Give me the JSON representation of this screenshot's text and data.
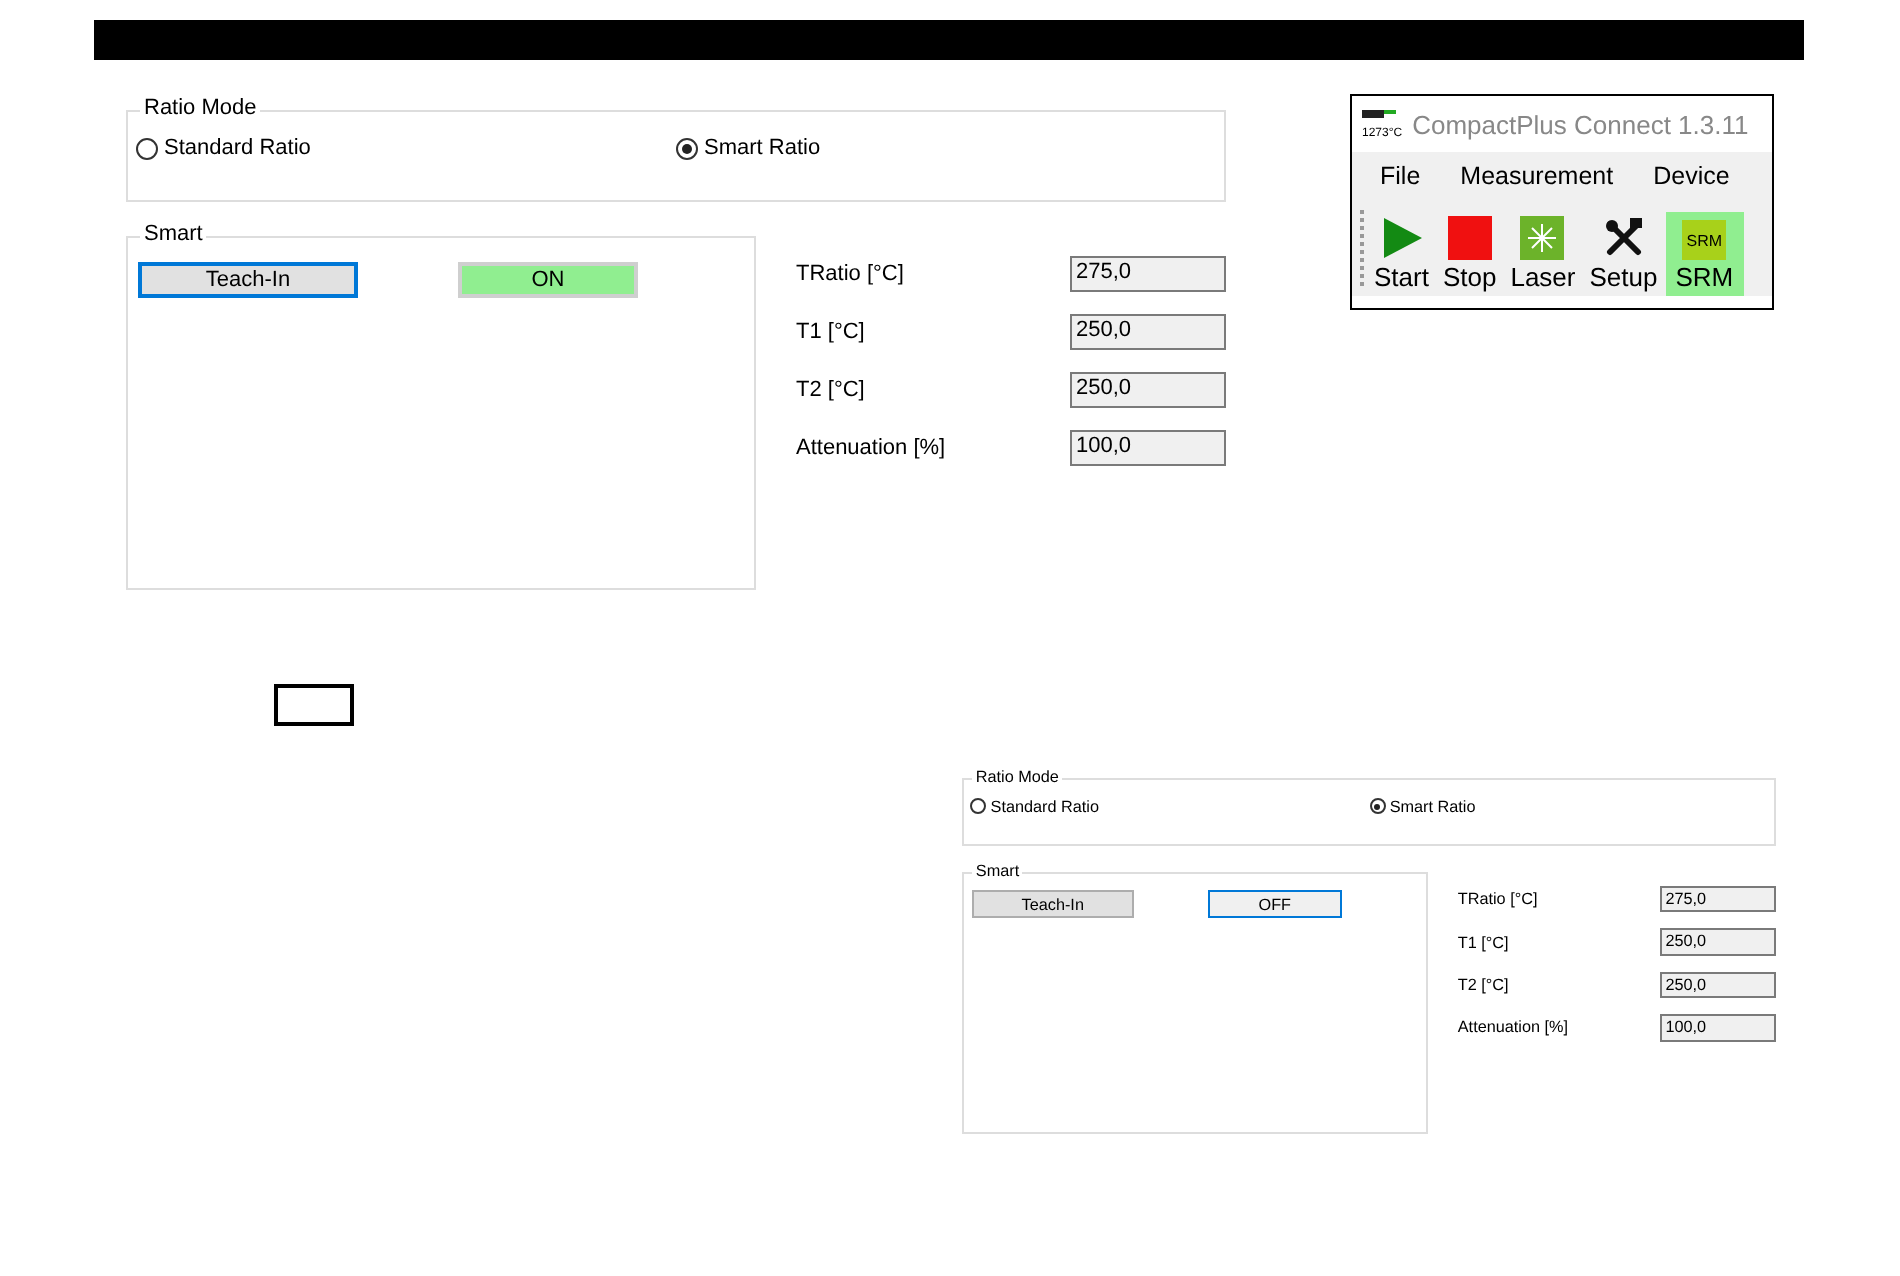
{
  "panels": [
    {
      "ratio_mode": {
        "title": "Ratio Mode",
        "options": [
          {
            "label": "Standard Ratio",
            "selected": false
          },
          {
            "label": "Smart Ratio",
            "selected": true
          }
        ]
      },
      "smart": {
        "title": "Smart",
        "teach_in": {
          "label": "Teach-In",
          "focused": true
        },
        "toggle": {
          "label": "ON",
          "on": true
        }
      },
      "fields": [
        {
          "label": "TRatio [°C]",
          "value": "275,0"
        },
        {
          "label": "T1 [°C]",
          "value": "250,0"
        },
        {
          "label": "T2 [°C]",
          "value": "250,0"
        },
        {
          "label": "Attenuation [%]",
          "value": "100,0"
        }
      ]
    },
    {
      "ratio_mode": {
        "title": "Ratio Mode",
        "options": [
          {
            "label": "Standard Ratio",
            "selected": false
          },
          {
            "label": "Smart Ratio",
            "selected": true
          }
        ]
      },
      "smart": {
        "title": "Smart",
        "teach_in": {
          "label": "Teach-In",
          "focused": false
        },
        "toggle": {
          "label": "OFF",
          "on": false
        }
      },
      "fields": [
        {
          "label": "TRatio [°C]",
          "value": "275,0"
        },
        {
          "label": "T1 [°C]",
          "value": "250,0"
        },
        {
          "label": "T2 [°C]",
          "value": "250,0"
        },
        {
          "label": "Attenuation [%]",
          "value": "100,0"
        }
      ]
    }
  ],
  "app_window": {
    "logo_text": "1273°C",
    "title": "CompactPlus Connect 1.3.11",
    "menu": [
      "File",
      "Measurement",
      "Device"
    ],
    "tools": [
      {
        "kind": "start",
        "label": "Start",
        "selected": false
      },
      {
        "kind": "stop",
        "label": "Stop",
        "selected": false
      },
      {
        "kind": "laser",
        "label": "Laser",
        "selected": false
      },
      {
        "kind": "setup",
        "label": "Setup",
        "selected": false
      },
      {
        "kind": "srm",
        "label": "SRM",
        "icon_text": "SRM",
        "selected": true
      }
    ]
  }
}
